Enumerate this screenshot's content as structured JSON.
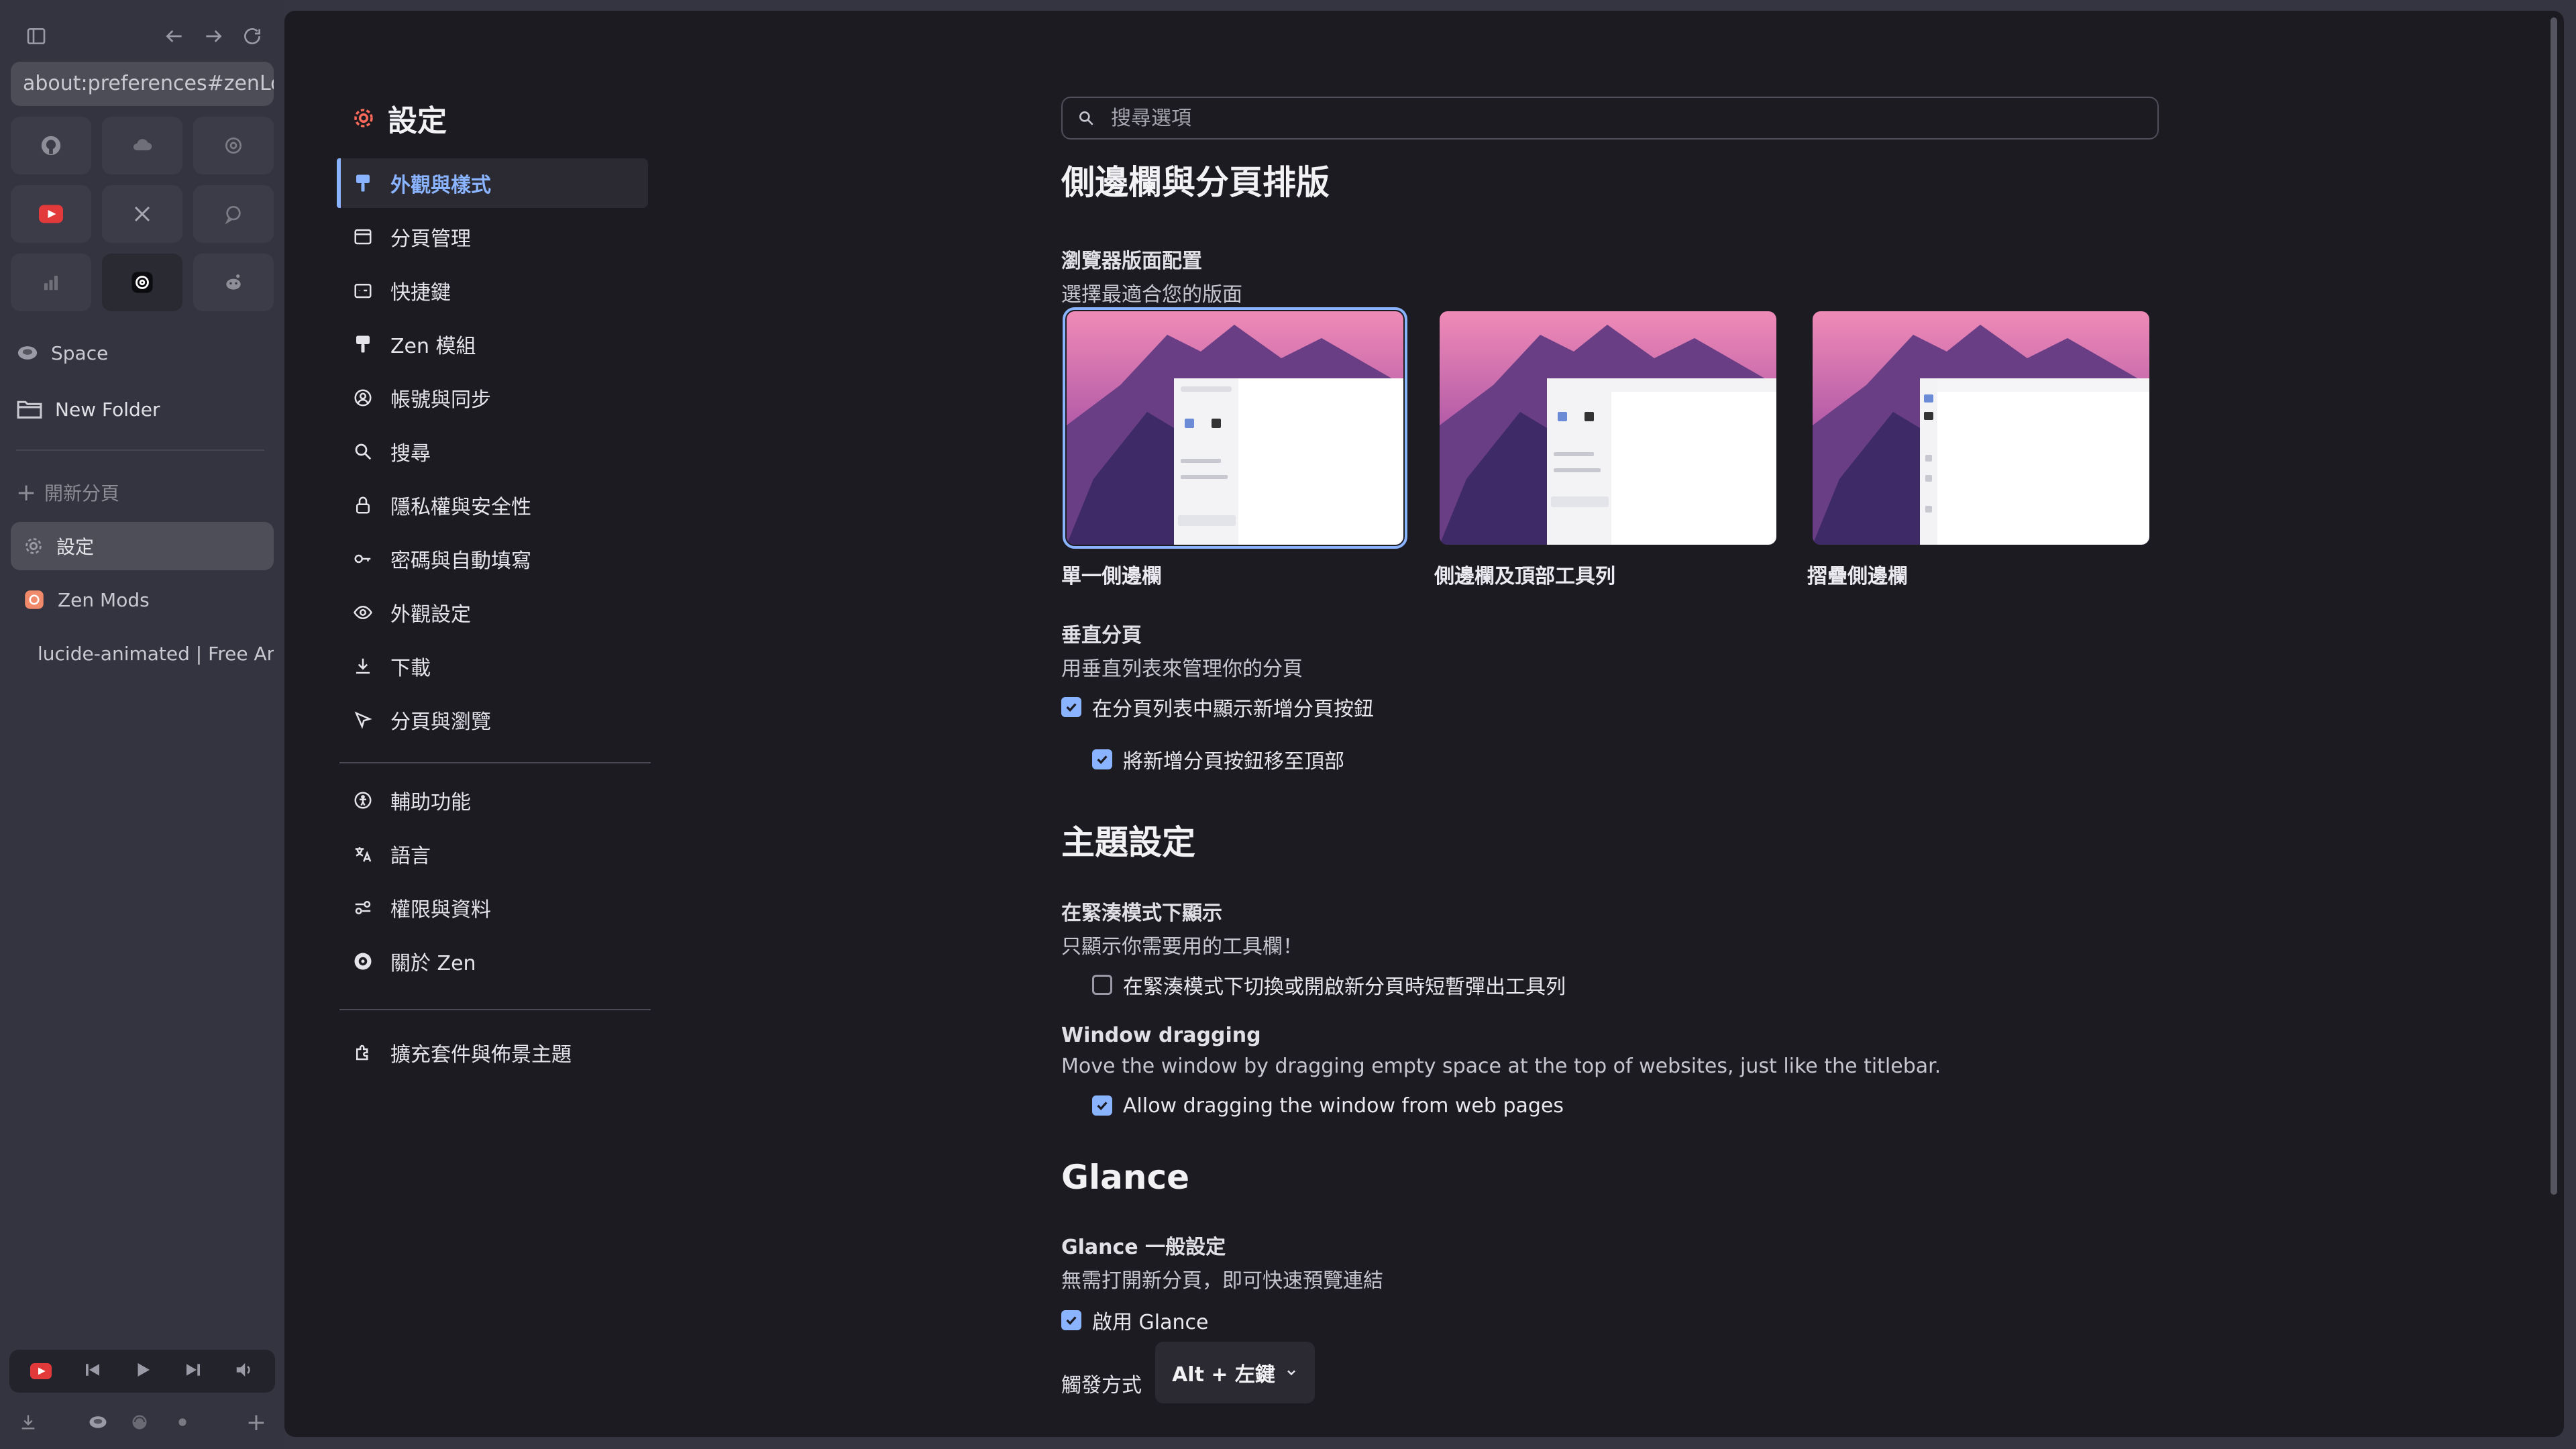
{
  "browser": {
    "url": "about:preferences#zenLooks",
    "essentials": [
      {
        "icon": "github-icon",
        "active": false
      },
      {
        "icon": "cloud-icon",
        "active": false
      },
      {
        "icon": "openai-icon",
        "active": false
      },
      {
        "icon": "youtube-icon",
        "active": false
      },
      {
        "icon": "x-twitter-icon",
        "active": false
      },
      {
        "icon": "chat-icon",
        "active": false
      },
      {
        "icon": "chart-icon",
        "active": false
      },
      {
        "icon": "threads-icon",
        "active": true
      },
      {
        "icon": "reddit-icon",
        "active": false
      }
    ],
    "workspace": "Space",
    "folder": "New Folder",
    "new_tab": "開新分頁",
    "tabs": [
      {
        "label": "設定",
        "icon": "gear-icon",
        "active": true
      },
      {
        "label": "Zen Mods",
        "icon": "zen-mods-icon",
        "active": false
      },
      {
        "label": "lucide-animated | Free Animated Icons",
        "icon": "lucide-icon",
        "active": false
      }
    ]
  },
  "prefs": {
    "title": "設定",
    "nav": [
      {
        "label": "外觀與樣式",
        "icon": "paint-icon",
        "selected": true
      },
      {
        "label": "分頁管理",
        "icon": "tab-management-icon",
        "selected": false
      },
      {
        "label": "快捷鍵",
        "icon": "keyboard-icon",
        "selected": false
      },
      {
        "label": "Zen 模組",
        "icon": "brush-icon",
        "selected": false
      },
      {
        "label": "帳號與同步",
        "icon": "account-icon",
        "selected": false
      },
      {
        "label": "搜尋",
        "icon": "search-icon",
        "selected": false
      },
      {
        "label": "隱私權與安全性",
        "icon": "lock-icon",
        "selected": false
      },
      {
        "label": "密碼與自動填寫",
        "icon": "key-icon",
        "selected": false
      },
      {
        "label": "外觀設定",
        "icon": "eye-icon",
        "selected": false
      },
      {
        "label": "下載",
        "icon": "download-icon",
        "selected": false
      },
      {
        "label": "分頁與瀏覽",
        "icon": "cursor-icon",
        "selected": false
      }
    ],
    "nav2": [
      {
        "label": "輔助功能",
        "icon": "accessibility-icon"
      },
      {
        "label": "語言",
        "icon": "language-icon"
      },
      {
        "label": "權限與資料",
        "icon": "permissions-icon"
      },
      {
        "label": "關於 Zen",
        "icon": "zen-logo-icon"
      }
    ],
    "nav3": [
      {
        "label": "擴充套件與佈景主題",
        "icon": "puzzle-icon"
      }
    ],
    "search_placeholder": "搜尋選項"
  },
  "section_layout": {
    "title": "側邊欄與分頁排版",
    "layout_title": "瀏覽器版面配置",
    "layout_desc": "選擇最適合您的版面",
    "layouts": [
      {
        "label": "單一側邊欄",
        "selected": true
      },
      {
        "label": "側邊欄及頂部工具列",
        "selected": false
      },
      {
        "label": "摺疊側邊欄",
        "selected": false
      }
    ],
    "vertical_title": "垂直分頁",
    "vertical_desc": "用垂直列表來管理你的分頁",
    "opt_show_new_tab": "在分頁列表中顯示新增分頁按鈕",
    "opt_show_new_tab_checked": true,
    "opt_move_top": "將新增分頁按鈕移至頂部",
    "opt_move_top_checked": true
  },
  "section_theme": {
    "title": "主題設定",
    "compact_title": "在緊湊模式下顯示",
    "compact_desc": "只顯示你需要用的工具欄！",
    "opt_compact_popup": "在緊湊模式下切換或開啟新分頁時短暫彈出工具列",
    "opt_compact_popup_checked": false,
    "drag_title": "Window dragging",
    "drag_desc": "Move the window by dragging empty space at the top of websites, just like the titlebar.",
    "opt_drag": "Allow dragging the window from web pages",
    "opt_drag_checked": true
  },
  "section_glance": {
    "title": "Glance",
    "general_title": "Glance 一般設定",
    "general_desc": "無需打開新分頁，即可快速預覽連結",
    "opt_enable": "啟用 Glance",
    "opt_enable_checked": true,
    "trigger_label": "觸發方式",
    "trigger_value": "Alt + 左鍵"
  },
  "colors": {
    "accent": "#8ab4ff",
    "content_bg": "#1c1b22",
    "sidebar_bg": "#343440"
  }
}
